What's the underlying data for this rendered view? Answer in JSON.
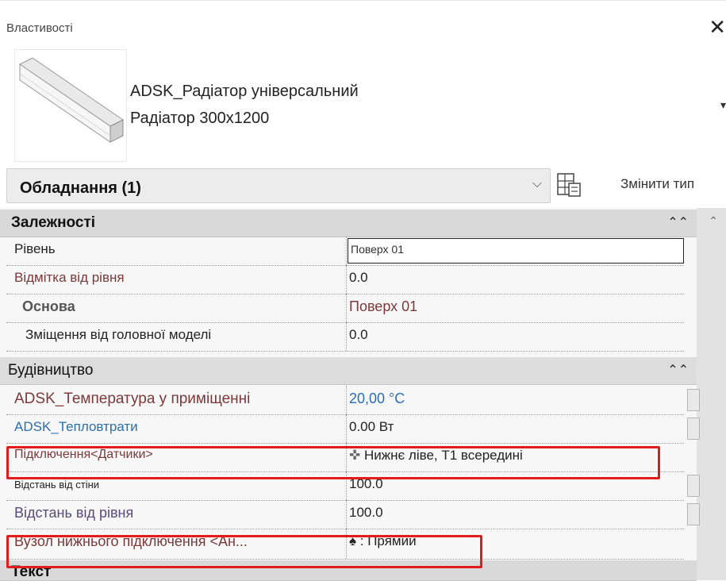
{
  "panel": {
    "title": "Властивості",
    "close_glyph": "✕"
  },
  "type_selector": {
    "family": "ADSK_Радіатор універсальний",
    "type": "Радіатор 300х1200",
    "chevron": "▾"
  },
  "filter": {
    "label": "Обладнання (1)",
    "dropdown_glyph": "⌵",
    "edit_type_label": "Змінити тип"
  },
  "groups": [
    {
      "title": "Залежності",
      "collapse_glyph": "⌃",
      "rows": [
        {
          "name": "Рівень",
          "value": "Поверх 01"
        },
        {
          "name": "Відмітка від рівня",
          "value": "0.0"
        },
        {
          "name": "Основа",
          "value": "Поверх 01"
        },
        {
          "name": "Зміщення від головної моделі",
          "value": "0.0"
        }
      ]
    },
    {
      "title": "Будівництво",
      "collapse_glyph": "⌃",
      "rows": [
        {
          "name": "ADSK_Температура у приміщенні",
          "value": "20,00 °C"
        },
        {
          "name": "ADSK_Тепловтрати",
          "value": "0.00 Вт"
        },
        {
          "name": "Підключення<Датчики>",
          "value": "Нижнє ліве, Т1 всередині"
        },
        {
          "name": "Відстань від стіни",
          "value": "100.0"
        },
        {
          "name": "Відстань від рівня",
          "value": "100.0"
        },
        {
          "name": "Вузол нижнього підключення <Ан...",
          "value": ": Прямий"
        }
      ]
    },
    {
      "title": "Текст"
    }
  ],
  "icons": {
    "connector": "✜",
    "spade": "♠"
  },
  "colors": {
    "highlight": "#e31b1b",
    "instance_param": "#7a3a3a",
    "value_blue": "#2a6fb0"
  }
}
